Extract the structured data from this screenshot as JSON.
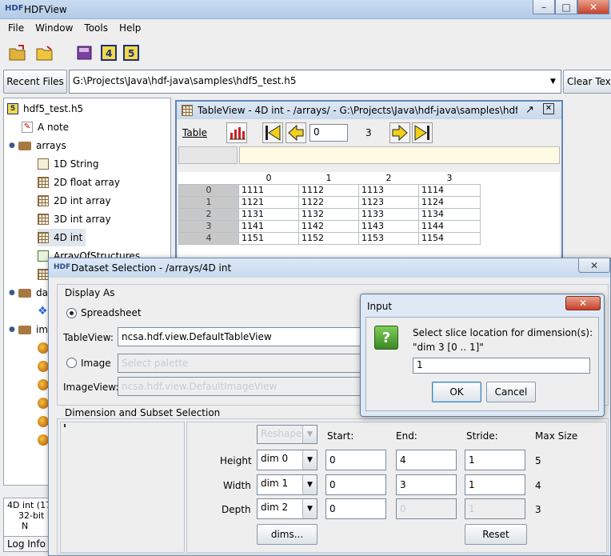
{
  "app": {
    "title": "HDFView",
    "menu": [
      "File",
      "Window",
      "Tools",
      "Help"
    ],
    "recent_files_label": "Recent Files",
    "recent_files_value": "G:\\Projects\\Java\\hdf-java\\samples\\hdf5_test.h5",
    "clear_text_label": "Clear Text"
  },
  "tree": {
    "root": "hdf5_test.h5",
    "items": [
      "A note",
      "arrays",
      "1D String",
      "2D float array",
      "2D int array",
      "3D int array",
      "4D int",
      "ArrayOfStructures"
    ],
    "partial_items": [
      "da",
      "im"
    ]
  },
  "status": {
    "line1": "4D int (17",
    "line2": "32-bit i",
    "line3": "N",
    "log_tab": "Log Info"
  },
  "tableview": {
    "title": "TableView - 4D int - /arrays/ - G:\\Projects\\Java\\hdf-java\\samples\\hdf5...",
    "menu_table": "Table",
    "page_value": "0",
    "page_max": "3",
    "columns": [
      "0",
      "1",
      "2",
      "3"
    ],
    "rows": [
      {
        "label": "0",
        "cells": [
          "1111",
          "1112",
          "1113",
          "1114"
        ]
      },
      {
        "label": "1",
        "cells": [
          "1121",
          "1122",
          "1123",
          "1124"
        ]
      },
      {
        "label": "2",
        "cells": [
          "1131",
          "1132",
          "1133",
          "1134"
        ]
      },
      {
        "label": "3",
        "cells": [
          "1141",
          "1142",
          "1143",
          "1144"
        ]
      },
      {
        "label": "4",
        "cells": [
          "1151",
          "1152",
          "1153",
          "1154"
        ]
      }
    ]
  },
  "dataset_selection": {
    "title": "Dataset Selection - /arrays/4D int",
    "display_as_label": "Display As",
    "spreadsheet_label": "Spreadsheet",
    "tableview_label": "TableView:",
    "tableview_value": "ncsa.hdf.view.DefaultTableView",
    "image_label": "Image",
    "palette_placeholder": "Select palette",
    "imageview_label": "ImageView:",
    "imageview_value": "ncsa.hdf.view.DefaultImageView",
    "dim_section_label": "Dimension and Subset Selection",
    "reshape_label": "Reshape",
    "col_start": "Start:",
    "col_end": "End:",
    "col_stride": "Stride:",
    "col_max": "Max Size",
    "rows": [
      {
        "label": "Height",
        "dim": "dim 0",
        "start": "0",
        "end": "4",
        "stride": "1",
        "max": "5"
      },
      {
        "label": "Width",
        "dim": "dim 1",
        "start": "0",
        "end": "3",
        "stride": "1",
        "max": "4"
      },
      {
        "label": "Depth",
        "dim": "dim 2",
        "start": "0",
        "end": "0",
        "stride": "1",
        "max": "3"
      }
    ],
    "dims_button": "dims...",
    "reset_button": "Reset"
  },
  "input_dialog": {
    "title": "Input",
    "message_line1": "Select slice location for dimension(s):",
    "message_line2": "\"dim 3 [0 .. 1]\"",
    "value": "1",
    "ok_label": "OK",
    "cancel_label": "Cancel"
  }
}
